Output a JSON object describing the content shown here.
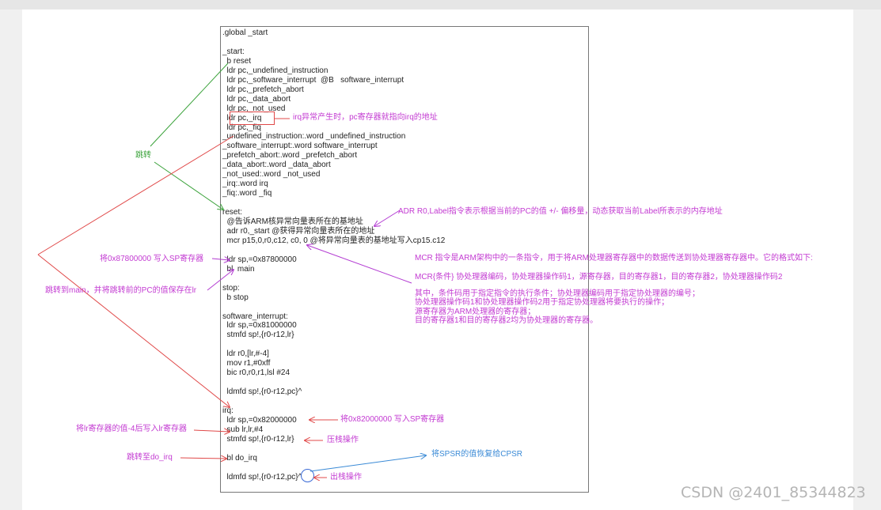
{
  "code_lines": [
    ".global _start",
    "",
    "_start:",
    "  b reset",
    "  ldr pc,_undefined_instruction",
    "  ldr pc,_software_interrupt  @B   software_interrupt",
    "  ldr pc,_prefetch_abort",
    "  ldr pc,_data_abort",
    "  ldr pc,_not_used",
    "  ldr pc,_irq",
    "  ldr pc,_fiq",
    "_undefined_instruction:.word _undefined_instruction",
    "_software_interrupt:.word software_interrupt",
    "_prefetch_abort:.word _prefetch_abort",
    "_data_abort:.word _data_abort",
    "_not_used:.word _not_used",
    "_irq:.word irq",
    "_fiq:.word _fiq",
    "",
    "reset:",
    "  @告诉ARM核异常向量表所在的基地址",
    "  adr r0,_start @获得异常向量表所在的地址",
    "  mcr p15,0,r0,c12, c0, 0 @将异常向量表的基地址写入cp15.c12",
    "",
    "  ldr sp,=0x87800000",
    "  bl  main",
    "",
    "stop:",
    "  b stop",
    "",
    "software_interrupt:",
    "  ldr sp,=0x81000000",
    "  stmfd sp!,{r0-r12,lr}",
    "",
    "  ldr r0,[lr,#-4]",
    "  mov r1,#0xff",
    "  bic r0,r0,r1,lsl #24",
    "",
    "  ldmfd sp!,{r0-r12,pc}^",
    "",
    "irq:",
    "  ldr sp,=0x82000000",
    "  sub lr,lr,#4",
    "  stmfd sp!,{r0-r12,lr}",
    "",
    "  bl do_irq",
    "",
    "  ldmfd sp!,{r0-r12,pc}^"
  ],
  "notes": {
    "irq_pc": "irq异常产生时，pc寄存器就指向irq的地址",
    "jump": "跳转",
    "adr": "ADR R0,Label指令表示根据当前的PC的值 +/- 偏移量，动态获取当前Label所表示的内存地址",
    "sp_87800000": "将0x87800000 写入SP寄存器",
    "mcr_title": "MCR 指令是ARM架构中的一条指令，用于将ARM处理器寄存器中的数据传送到协处理器寄存器中。它的格式如下:",
    "mcr_format": "MCR{条件} 协处理器编码，协处理器操作码1，源寄存器，目的寄存器1，目的寄存器2，协处理器操作码2",
    "mcr_desc_1": "其中，条件码用于指定指令的执行条件；协处理器编码用于指定协处理器的编号；",
    "mcr_desc_2": "协处理器操作码1和协处理器操作码2用于指定协处理器将要执行的操作；",
    "mcr_desc_3": "源寄存器为ARM处理器的寄存器；",
    "mcr_desc_4": "目的寄存器1和目的寄存器2均为协处理器的寄存器。",
    "jump_main": "跳转到main，并将跳转前的PC的值保存在lr",
    "sp_82000000": "将0x82000000 写入SP寄存器",
    "lr_minus4": "将lr寄存器的值-4后写入lr寄存器",
    "push": "压栈操作",
    "jump_do_irq": "跳转至do_irq",
    "spsr": "将SPSR的值恢复给CPSR",
    "pop": "出栈操作"
  },
  "colors": {
    "purple": "#c33bd2",
    "green": "#3aa23a",
    "red": "#e04848",
    "blue": "#3a8ad6"
  },
  "watermark": "CSDN @2401_85344823"
}
